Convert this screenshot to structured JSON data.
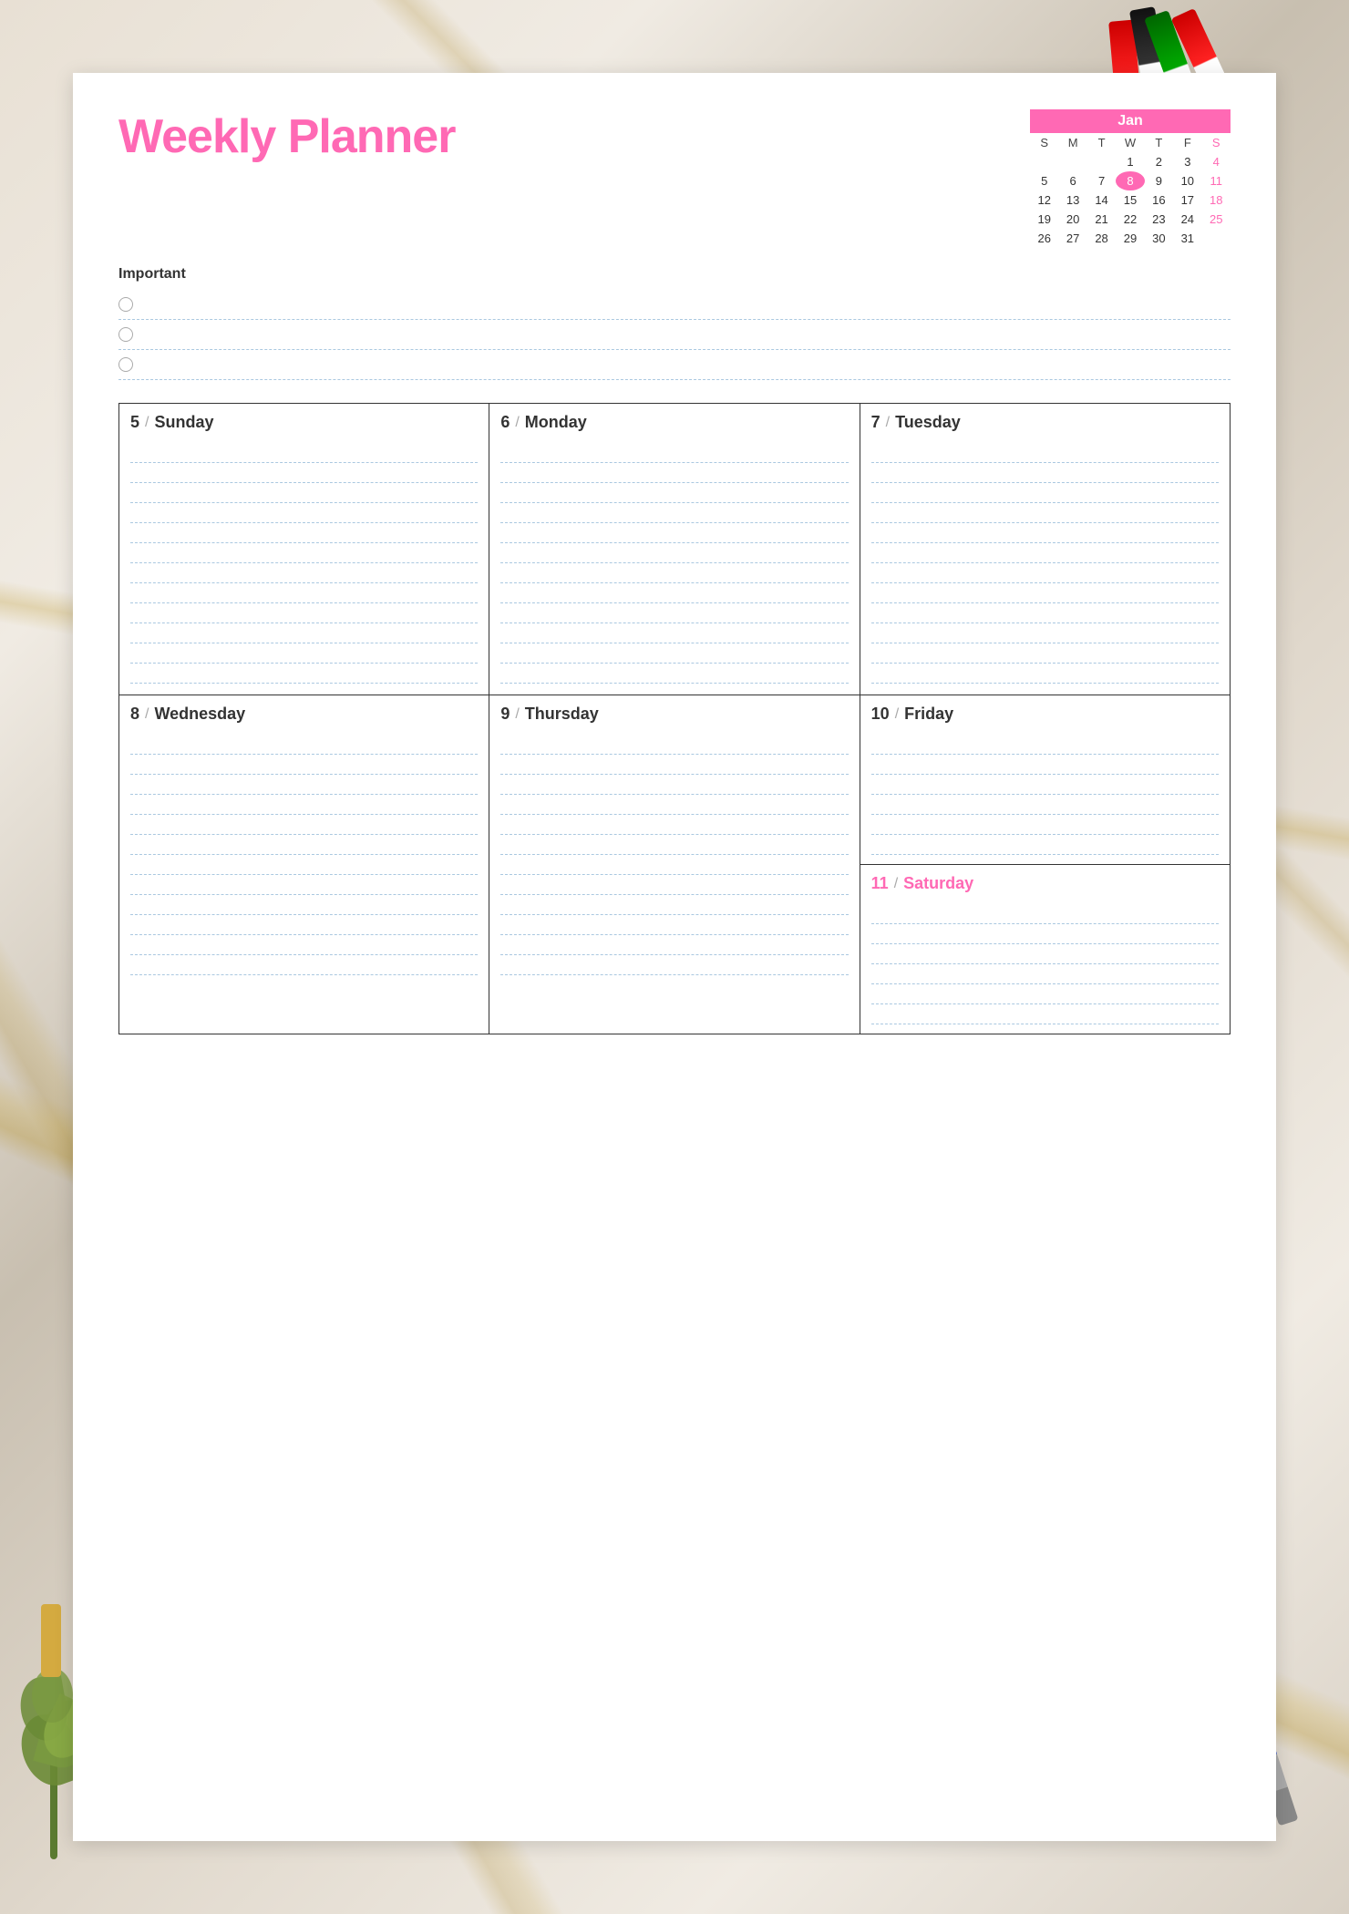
{
  "title": "Weekly Planner",
  "calendar": {
    "month": "Jan",
    "headers": [
      "S",
      "M",
      "T",
      "W",
      "T",
      "F",
      "S"
    ],
    "rows": [
      [
        "",
        "",
        "",
        "1",
        "2",
        "3",
        "4"
      ],
      [
        "5",
        "6",
        "7",
        "8",
        "9",
        "10",
        "11"
      ],
      [
        "12",
        "13",
        "14",
        "15",
        "16",
        "17",
        "18"
      ],
      [
        "19",
        "20",
        "21",
        "22",
        "23",
        "24",
        "25"
      ],
      [
        "26",
        "27",
        "28",
        "29",
        "30",
        "31",
        ""
      ]
    ],
    "highlight": "8"
  },
  "important": {
    "label": "Important",
    "items": [
      "",
      "",
      ""
    ]
  },
  "days_top": [
    {
      "number": "5",
      "name": "Sunday",
      "saturday": false
    },
    {
      "number": "6",
      "name": "Monday",
      "saturday": false
    },
    {
      "number": "7",
      "name": "Tuesday",
      "saturday": false
    }
  ],
  "days_bottom_left": [
    {
      "number": "8",
      "name": "Wednesday",
      "saturday": false
    },
    {
      "number": "9",
      "name": "Thursday",
      "saturday": false
    }
  ],
  "day_friday": {
    "number": "10",
    "name": "Friday",
    "saturday": false
  },
  "day_saturday": {
    "number": "11",
    "name": "Saturday",
    "saturday": true
  },
  "lines_count": 10
}
